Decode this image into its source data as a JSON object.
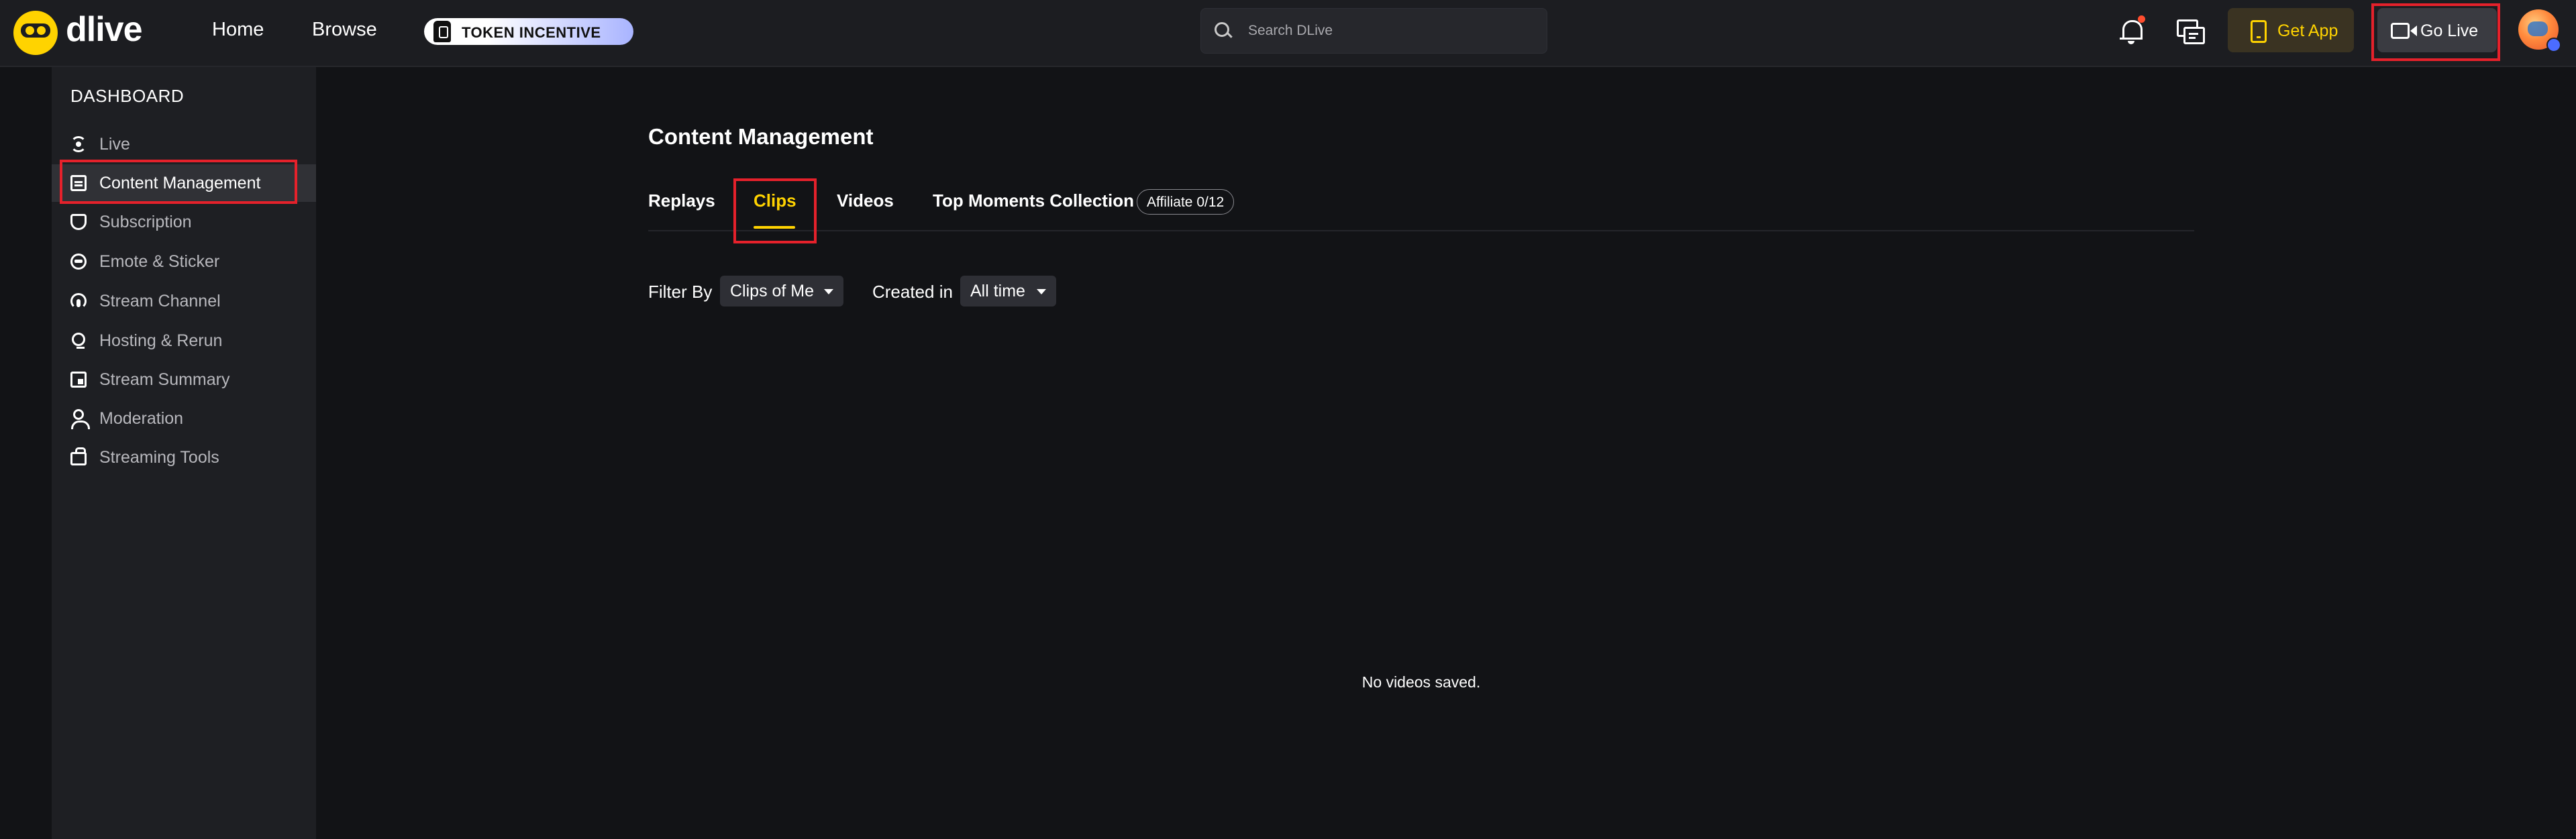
{
  "header": {
    "brand": "dlive",
    "nav": {
      "home": "Home",
      "browse": "Browse"
    },
    "token_incentive": "TOKEN INCENTIVE",
    "search": {
      "placeholder": "Search DLive",
      "value": ""
    },
    "get_app": "Get App",
    "go_live": "Go Live",
    "colors": {
      "accent": "#ffd300",
      "notification_dot": "#ff4d2e"
    }
  },
  "sidebar": {
    "title": "DASHBOARD",
    "items": [
      {
        "label": "Live",
        "icon": "live-icon"
      },
      {
        "label": "Content Management",
        "icon": "content-management-icon",
        "active": true
      },
      {
        "label": "Subscription",
        "icon": "subscription-icon"
      },
      {
        "label": "Emote & Sticker",
        "icon": "emote-icon"
      },
      {
        "label": "Stream Channel",
        "icon": "stream-channel-icon"
      },
      {
        "label": "Hosting & Rerun",
        "icon": "hosting-icon"
      },
      {
        "label": "Stream Summary",
        "icon": "stream-summary-icon"
      },
      {
        "label": "Moderation",
        "icon": "moderation-icon"
      },
      {
        "label": "Streaming Tools",
        "icon": "streaming-tools-icon"
      }
    ]
  },
  "main": {
    "title": "Content Management",
    "tabs": [
      {
        "label": "Replays"
      },
      {
        "label": "Clips",
        "active": true
      },
      {
        "label": "Videos"
      },
      {
        "label": "Top Moments Collection"
      }
    ],
    "affiliate_badge": "Affiliate 0/12",
    "filter_by_label": "Filter By",
    "filter_by_value": "Clips of Me",
    "created_in_label": "Created in",
    "created_in_value": "All time",
    "empty_message": "No videos saved."
  }
}
